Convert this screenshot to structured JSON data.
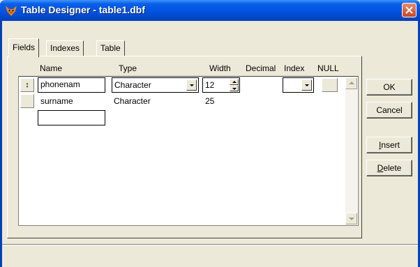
{
  "window": {
    "title": "Table Designer - table1.dbf"
  },
  "tabs": [
    {
      "label": "Fields"
    },
    {
      "label": "Indexes"
    },
    {
      "label": "Table"
    }
  ],
  "columns": {
    "name": "Name",
    "type": "Type",
    "width": "Width",
    "decimal": "Decimal",
    "index": "Index",
    "null": "NULL"
  },
  "rows": [
    {
      "selector": "↕",
      "name": "phonenam",
      "type": "Character",
      "width": "12",
      "decimal": "",
      "index": ""
    },
    {
      "selector": "",
      "name": "surname",
      "type": "Character",
      "width": "25",
      "decimal": "",
      "index": ""
    },
    {
      "selector": "",
      "name": "",
      "type": "",
      "width": "",
      "decimal": "",
      "index": ""
    }
  ],
  "buttons": {
    "ok": "OK",
    "cancel": "Cancel",
    "insert_pre": "",
    "insert_key": "I",
    "insert_post": "nsert",
    "delete_pre": "",
    "delete_key": "D",
    "delete_post": "elete"
  },
  "icons": {
    "app": "fox-icon",
    "close": "close-icon"
  },
  "colors": {
    "titlebar": "#0054E3",
    "close": "#C94524",
    "face": "#ECE9D8"
  }
}
